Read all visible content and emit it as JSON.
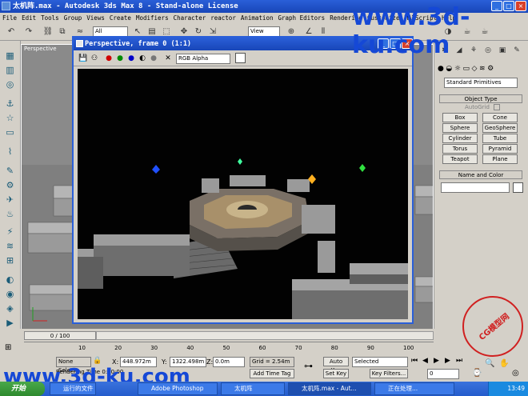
{
  "window": {
    "title": "太机阵.max - Autodesk 3ds Max 8  - Stand-alone License"
  },
  "menu": [
    "File",
    "Edit",
    "Tools",
    "Group",
    "Views",
    "Create",
    "Modifiers",
    "Character",
    "reactor",
    "Animation",
    "Graph Editors",
    "Rendering",
    "Customize",
    "MAXScript",
    "Help"
  ],
  "toolbar": {
    "selection_filter": "All",
    "view_dropdown": "View"
  },
  "watermark": {
    "text": "www.3d-ku.com",
    "stamp": "CG模型网"
  },
  "viewport": {
    "label": "Perspective"
  },
  "render_window": {
    "title": "Perspective, frame 0 (1:1)",
    "channel": "RGB Alpha"
  },
  "command_panel": {
    "category": "Standard Primitives",
    "object_type": {
      "header": "Object Type",
      "autogrid": "AutoGrid",
      "buttons": [
        "Box",
        "Cone",
        "Sphere",
        "GeoSphere",
        "Cylinder",
        "Tube",
        "Torus",
        "Pyramid",
        "Teapot",
        "Plane"
      ]
    },
    "name_color": {
      "header": "Name and Color"
    }
  },
  "timeline": {
    "slider": "0 / 100",
    "ticks": [
      "10",
      "20",
      "30",
      "40",
      "50",
      "60",
      "70",
      "80",
      "90",
      "100"
    ],
    "tick_values": [
      10,
      20,
      30,
      40,
      50,
      60,
      70,
      80,
      90,
      100
    ]
  },
  "status": {
    "selection": "None Selecte",
    "prompt": "Rendering Time 0:00:00",
    "x": "448.972m",
    "y": "1322.498m",
    "z": "0.0m",
    "grid": "Grid = 2.54m",
    "add_time_tag": "Add Time Tag",
    "auto_key": "Auto Key",
    "set_key": "Set Key",
    "key_mode": "Selected",
    "key_filters": "Key Filters...",
    "frame": "0"
  },
  "taskbar": {
    "start": "开始",
    "tasks": [
      "运行的文件",
      "Adobe Photoshop",
      "太机阵",
      "太机阵.max - Aut...",
      "正在处理..."
    ],
    "clock": "13:49"
  },
  "colors": {
    "title_blue": "#1846b8",
    "ui_gray": "#d4d0c8",
    "watermark_blue": "#1548d6",
    "stamp_red": "#d02020"
  }
}
